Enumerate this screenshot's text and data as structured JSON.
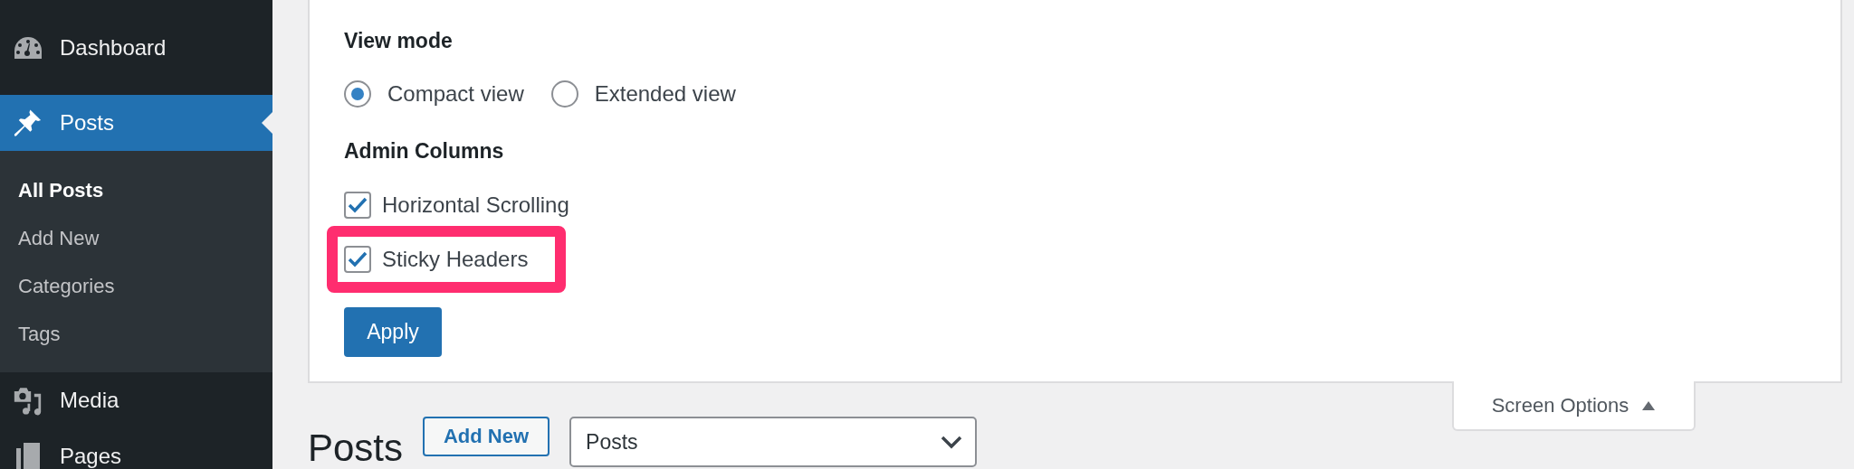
{
  "sidebar": {
    "items": [
      {
        "label": "Dashboard",
        "selected": false
      },
      {
        "label": "Posts",
        "selected": true,
        "children": [
          {
            "label": "All Posts",
            "selected": true
          },
          {
            "label": "Add New",
            "selected": false
          },
          {
            "label": "Categories",
            "selected": false
          },
          {
            "label": "Tags",
            "selected": false
          }
        ]
      },
      {
        "label": "Media",
        "selected": false
      },
      {
        "label": "Pages",
        "selected": false
      }
    ]
  },
  "screen_options": {
    "view_mode": {
      "title": "View mode",
      "options": [
        {
          "label": "Compact view",
          "selected": true
        },
        {
          "label": "Extended view",
          "selected": false
        }
      ]
    },
    "admin_columns": {
      "title": "Admin Columns",
      "options": [
        {
          "label": "Horizontal Scrolling",
          "checked": true,
          "highlighted": false
        },
        {
          "label": "Sticky Headers",
          "checked": true,
          "highlighted": true
        }
      ]
    },
    "apply_button": "Apply",
    "toggle": {
      "label": "Screen Options",
      "expanded": true
    }
  },
  "heading": {
    "title": "Posts",
    "add_new_button": "Add New",
    "post_type_select": {
      "value": "Posts"
    }
  }
}
